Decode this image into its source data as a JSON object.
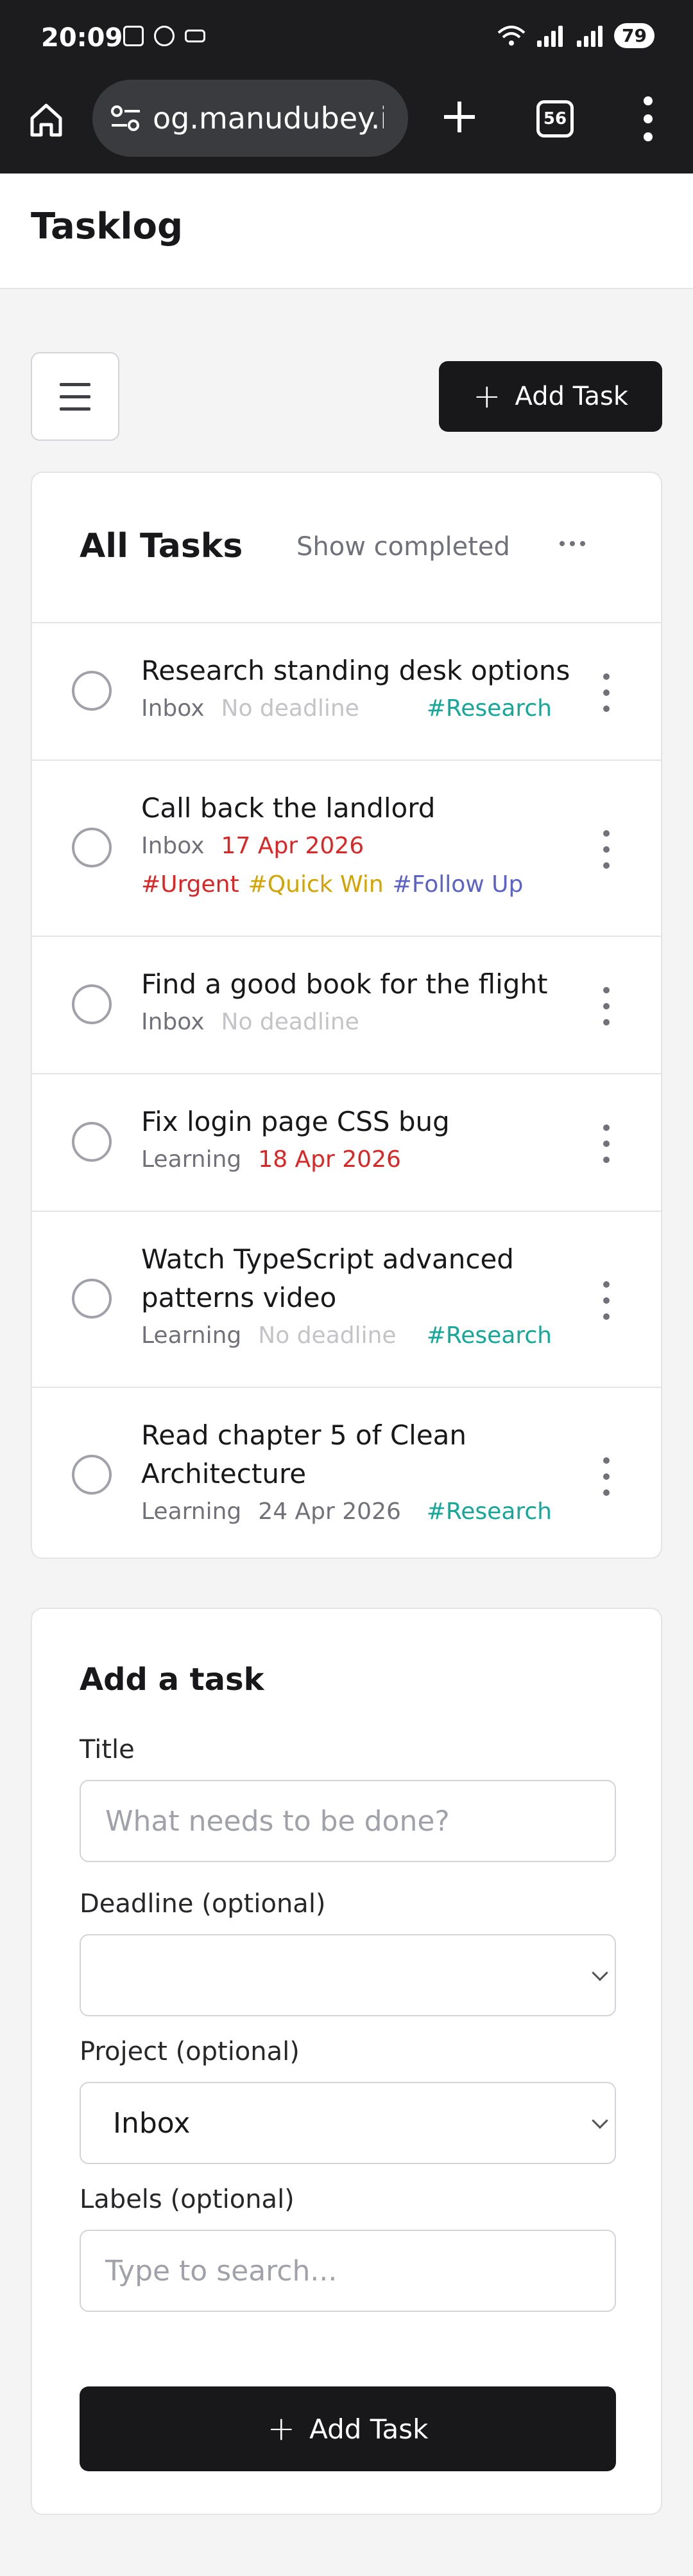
{
  "status_bar": {
    "time": "20:09",
    "battery": "79"
  },
  "browser": {
    "url": "og.manudubey.in",
    "tab_count": "56"
  },
  "app": {
    "title": "Tasklog"
  },
  "toolbar": {
    "add_task_label": "Add Task"
  },
  "task_list": {
    "title": "All Tasks",
    "show_completed_label": "Show completed",
    "tasks": [
      {
        "title": "Research standing desk options",
        "project": "Inbox",
        "deadline": "No deadline",
        "labels": [
          "#Research"
        ]
      },
      {
        "title": "Call back the landlord",
        "project": "Inbox",
        "deadline": "17 Apr 2026",
        "labels": [
          "#Urgent",
          "#Quick Win",
          "#Follow Up"
        ]
      },
      {
        "title": "Find a good book for the flight",
        "project": "Inbox",
        "deadline": "No deadline",
        "labels": []
      },
      {
        "title": "Fix login page CSS bug",
        "project": "Learning",
        "deadline": "18 Apr 2026",
        "labels": []
      },
      {
        "title": "Watch TypeScript advanced patterns video",
        "project": "Learning",
        "deadline": "No deadline",
        "labels": [
          "#Research"
        ]
      },
      {
        "title": "Read chapter 5 of Clean Architecture",
        "project": "Learning",
        "deadline": "24 Apr 2026",
        "labels": [
          "#Research"
        ]
      }
    ]
  },
  "add_form": {
    "title": "Add a task",
    "title_label": "Title",
    "title_placeholder": "What needs to be done?",
    "deadline_label": "Deadline (optional)",
    "deadline_value": "",
    "project_label": "Project (optional)",
    "project_value": "Inbox",
    "labels_label": "Labels (optional)",
    "labels_placeholder": "Type to search...",
    "submit_label": "Add Task"
  },
  "colors": {
    "research": "#14a89a",
    "urgent": "#dc2626",
    "quick_win": "#d4a300",
    "follow_up": "#5b62c8",
    "overdue": "#dc2626",
    "primary_button": "#18181b"
  }
}
